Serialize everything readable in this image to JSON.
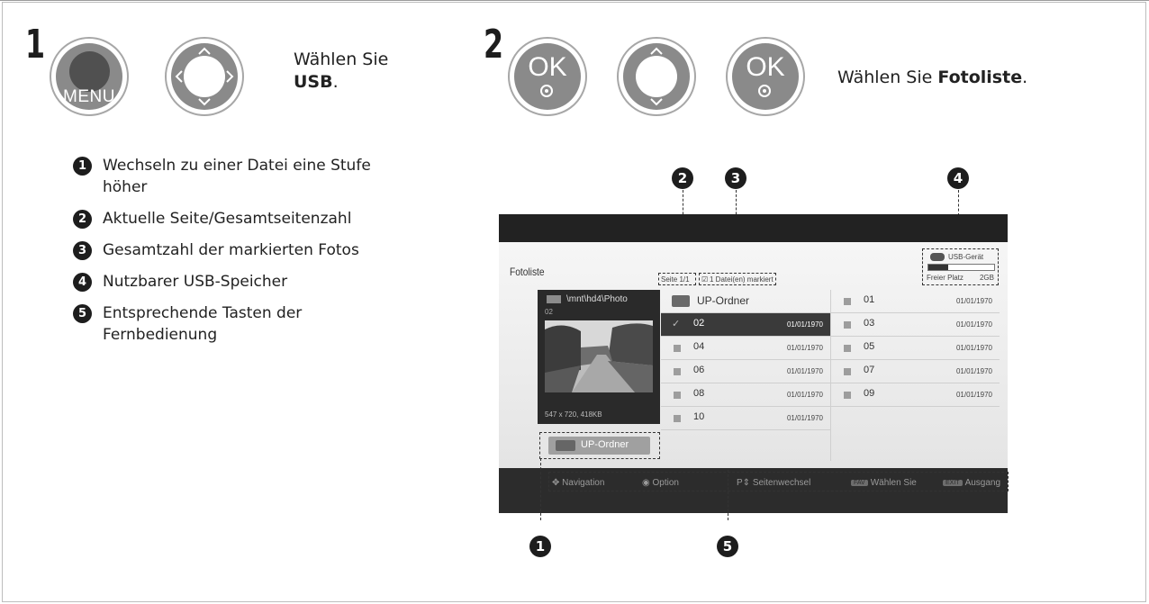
{
  "step1": {
    "number": "1",
    "menu_label": "MENU",
    "instruction_prefix": "Wählen Sie",
    "instruction_target": "USB",
    "instruction_suffix": "."
  },
  "step2": {
    "number": "2",
    "ok_label": "OK",
    "instruction_prefix": "Wählen Sie ",
    "instruction_target": "Fotoliste",
    "instruction_suffix": "."
  },
  "legend": [
    {
      "num": "1",
      "text": "Wechseln zu einer Datei eine Stufe höher"
    },
    {
      "num": "2",
      "text": "Aktuelle Seite/Gesamtseitenzahl"
    },
    {
      "num": "3",
      "text": "Gesamtzahl der markierten Fotos"
    },
    {
      "num": "4",
      "text": "Nutzbarer USB-Speicher"
    },
    {
      "num": "5",
      "text": "Entsprechende Tasten der Fernbedienung"
    }
  ],
  "callouts": [
    "1",
    "2",
    "3",
    "4",
    "5"
  ],
  "screen": {
    "title": "Fotoliste",
    "page_info": "Seite  1/1",
    "marked_info": "1 Datei(en) markiert",
    "usb_label": "USB-Gerät",
    "free_label": "Freier Platz",
    "free_value": "2GB",
    "usb_fill_fraction": 0.3,
    "path": "\\mnt\\hd4\\Photo",
    "preview_name": "02",
    "preview_info": "547 x 720, 418KB",
    "up_button": "UP-Ordner",
    "files_left": [
      {
        "name": "UP-Ordner",
        "date": "",
        "folder": true
      },
      {
        "name": "02",
        "date": "01/01/1970",
        "selected": true
      },
      {
        "name": "04",
        "date": "01/01/1970"
      },
      {
        "name": "06",
        "date": "01/01/1970"
      },
      {
        "name": "08",
        "date": "01/01/1970"
      },
      {
        "name": "10",
        "date": "01/01/1970"
      }
    ],
    "files_right": [
      {
        "name": "01",
        "date": "01/01/1970"
      },
      {
        "name": "03",
        "date": "01/01/1970"
      },
      {
        "name": "05",
        "date": "01/01/1970"
      },
      {
        "name": "07",
        "date": "01/01/1970"
      },
      {
        "name": "09",
        "date": "01/01/1970"
      }
    ],
    "footer": {
      "navigation": "Navigation",
      "option": "Option",
      "page_change": "Seitenwechsel",
      "fav_key": "FAV",
      "select": "Wählen Sie",
      "exit_key": "EXIT",
      "exit": "Ausgang"
    }
  }
}
